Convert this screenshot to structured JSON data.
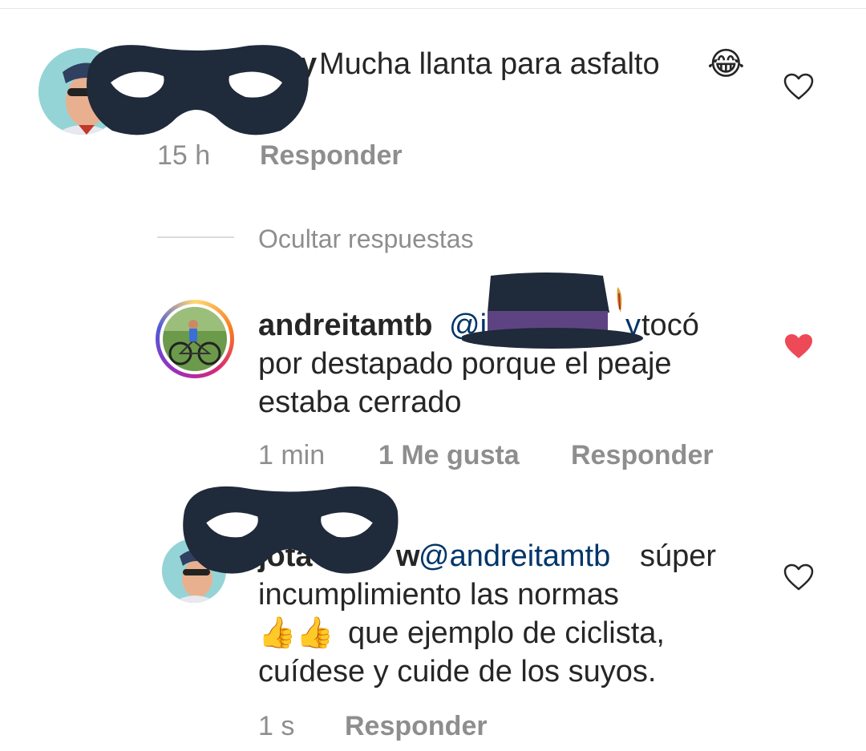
{
  "comments": [
    {
      "username_tail": "y",
      "text": "Mucha llanta para asfalto",
      "emoji": "😂",
      "time": "15 h",
      "reply_label": "Responder",
      "liked": false
    }
  ],
  "hide_replies_label": "Ocultar respuestas",
  "replies": [
    {
      "username": "andreitamtb",
      "mention_visible": "@j",
      "mention_tail": "y",
      "line1_rest": "tocó",
      "line2": "por destapado porque el peaje",
      "line3": "estaba cerrado",
      "time": "1 min",
      "likes": "1 Me gusta",
      "reply_label": "Responder",
      "liked": true
    },
    {
      "username_partial": "jota",
      "username_tail": "w",
      "mention": "@andreitamtb",
      "line1_rest": "súper",
      "line2": "incumplimiento las normas",
      "line3_emoji": "👍👍",
      "line3_text": "que ejemplo de ciclista,",
      "line4": "cuídese y cuide de los suyos.",
      "time": "1 s",
      "reply_label": "Responder",
      "liked": false
    }
  ],
  "colors": {
    "text": "#262626",
    "meta": "#8e8e8e",
    "mention": "#003569",
    "liked_heart": "#ed4956",
    "mask": "#1f2a3a",
    "hat_band": "#5e4382"
  },
  "icons": {
    "heart_outline": "heart-outline-icon",
    "heart_filled": "heart-filled-icon"
  }
}
